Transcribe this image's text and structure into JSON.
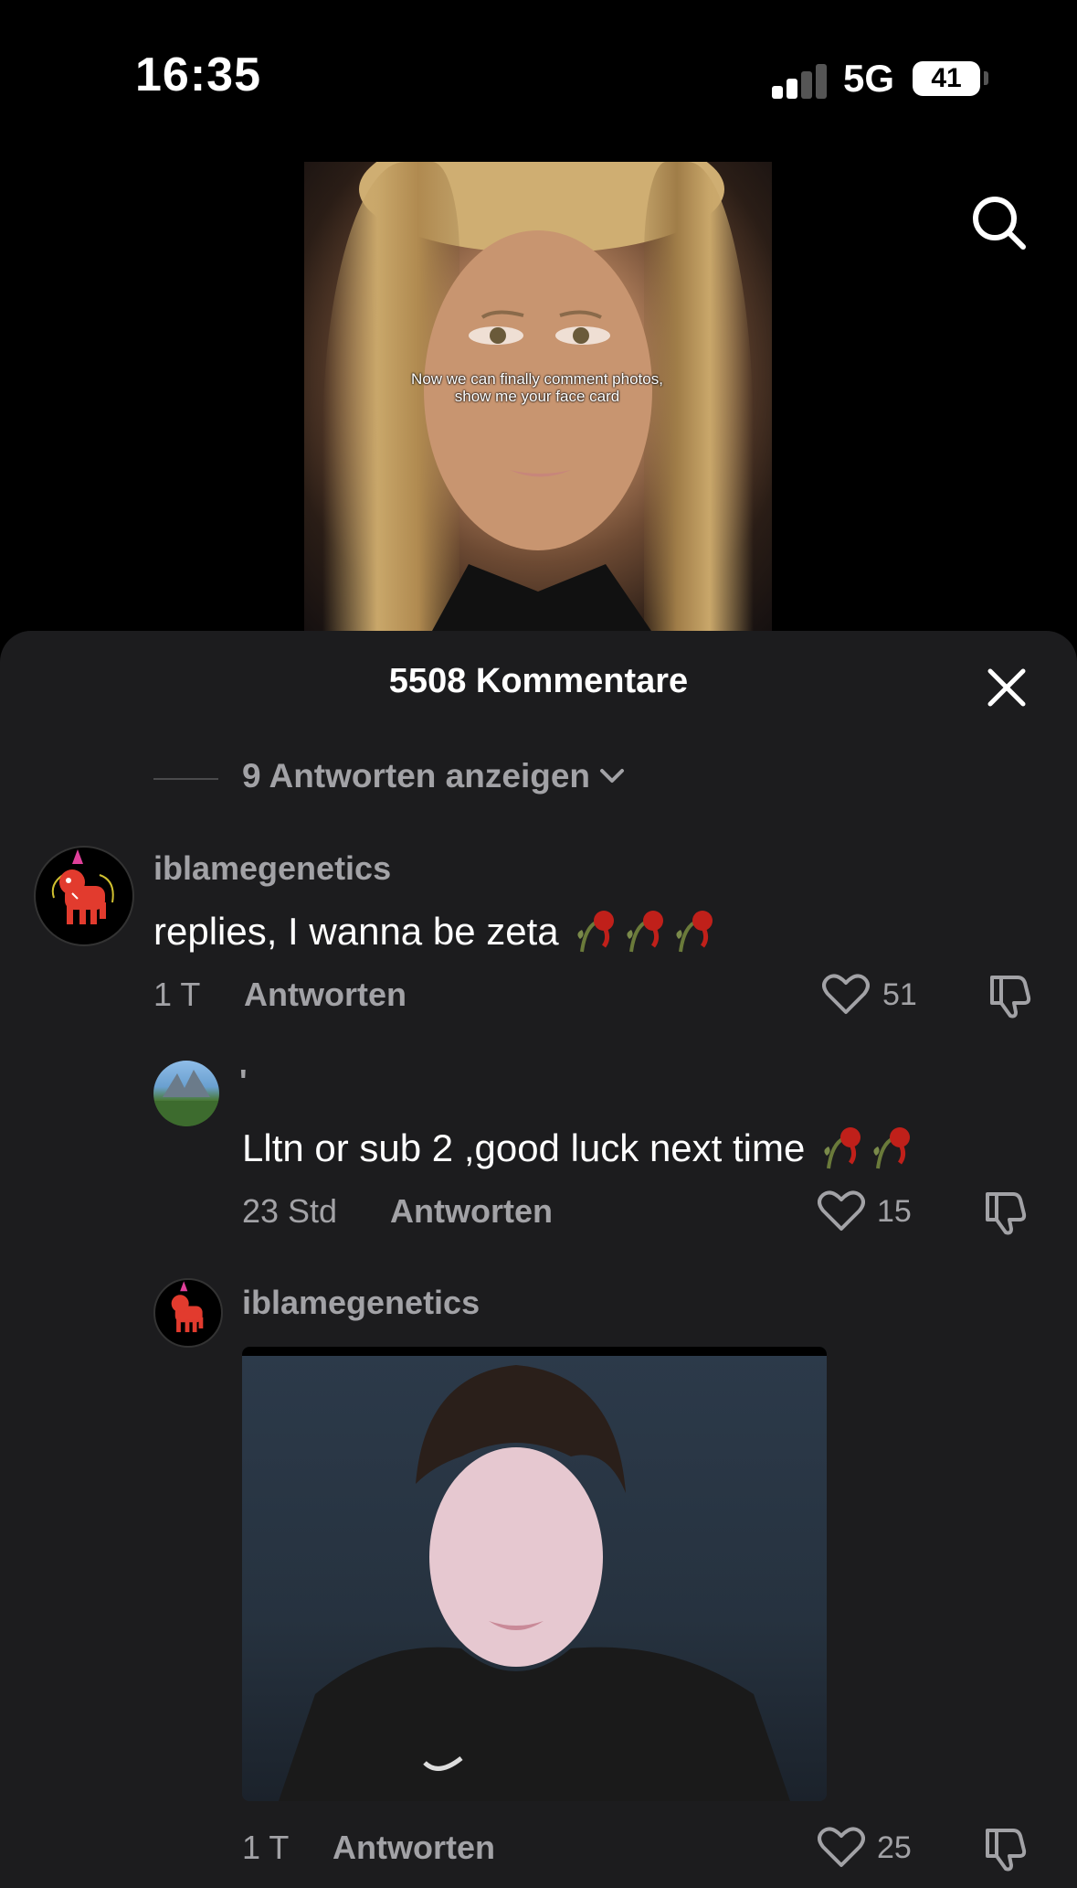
{
  "status_bar": {
    "time": "16:35",
    "network": "5G",
    "battery": "41"
  },
  "video": {
    "caption": "Now we can finally comment photos, show me your face card"
  },
  "comments_sheet": {
    "title": "5508 Kommentare",
    "view_replies": "9 Antworten anzeigen",
    "comments": [
      {
        "username": "iblamegenetics",
        "text": "replies, I wanna be zeta",
        "emoji": "wilted-rose x3",
        "time": "1 T",
        "reply_label": "Antworten",
        "likes": "51"
      },
      {
        "username": "'",
        "text": "Lltn or sub 2 ,good luck next time",
        "emoji": "wilted-rose x2",
        "time": "23 Std",
        "reply_label": "Antworten",
        "likes": "15"
      },
      {
        "username": "iblamegenetics",
        "text": "",
        "attachment": "photo",
        "time": "1 T",
        "reply_label": "Antworten",
        "likes": "25"
      }
    ]
  },
  "icons": [
    "search-icon",
    "close-icon",
    "chevron-down-icon",
    "heart-icon",
    "dislike-icon",
    "wilted-rose-emoji"
  ],
  "colors": {
    "sheet_bg": "#1c1c1e",
    "secondary_text": "#a2a2a6",
    "accent_avatar": "#e23b2e"
  }
}
